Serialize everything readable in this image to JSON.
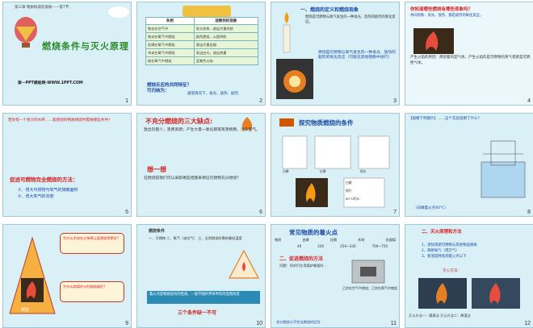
{
  "slides": [
    {
      "number": "1",
      "top_text": "第三章 物质构成的奥秘——第7节",
      "title": "燃烧条件与灭火原理",
      "url": "第一PPT模板网-WWW.1PPT.COM"
    },
    {
      "number": "2",
      "table_headers": [
        "条例",
        "观察到的现象"
      ],
      "table_rows": [
        [
          "铁丝在空气中",
          "发光发热…放出大量的热"
        ],
        [
          "铁丝在氧气中燃烧",
          "剧烈燃烧…火星四射"
        ],
        [
          "红磷在氧气中燃烧",
          "冒出大量白烟"
        ],
        [
          "木炭在氧气中燃烧",
          "发出白光，放出热量"
        ],
        [
          "硫在氧气中燃烧",
          "蓝紫色火焰"
        ]
      ],
      "question": "燃烧反应的共同特征？\n可归纳为：",
      "answer": "通常情况下，发光、放热、剧烈"
    },
    {
      "number": "3",
      "title": "一、燃烧的定义和燃烧现象",
      "text": "燃烧是可燃物与氧气发生的一种发光、放热的剧烈的氧化反应。",
      "text2": "燃烧是可燃物与氧气发生的一种发光、放热的剧烈的氧化反应（可能在其他物质中进行）"
    },
    {
      "number": "4",
      "title": "你知道哪些燃烧有哪些现象吗？",
      "text": "共同现象：发光、放热、都是剧烈的氧化反应。",
      "bottom": "产生火焰的原因：燃烧着的是气体。产生火焰的是可燃物的蒸气或者是可燃性气体。"
    },
    {
      "number": "5",
      "text": "若你有一个很大的水杯……能燃烧的物质燃烧时需要哪些条件？",
      "head": "促进可燃物完全燃烧的方法：",
      "items": [
        "①、增大可燃物与氧气的接触面积",
        "②、增大氧气的浓度"
      ]
    },
    {
      "number": "6",
      "title": "不充分燃烧的三大缺点:",
      "text": "放出热量少，浪费资源；产生大量一氧化碳等有害物质，污染空气。",
      "think": "想一想",
      "text2": "在燃烧前我们可以采取哪些措施来保证可燃物充分燃烧？"
    },
    {
      "number": "7",
      "title": "探究物质燃烧的条件",
      "labels": [
        "白磷",
        "红磷",
        "热水",
        "白磷",
        "铜片",
        "80°C的水"
      ]
    },
    {
      "number": "8",
      "text": "【观察下列图片】……这个实验说明了什么？",
      "foot": "（白磷着火点40°C）"
    },
    {
      "number": "9",
      "box1": "为什么木块在火柴棒上面燃烧得更好？",
      "box2": "为什么扇煤炉火时越扇越旺？",
      "box3": "燃烧"
    },
    {
      "number": "10",
      "title": "燃烧条件",
      "text": "一、可燃物 二、氧气（或空气） 三、达到燃烧所需的最低温度",
      "bar": "着火点是物质固有的性质，一般不随外界条件的改变而改变",
      "foot": "三个条件缺一不可"
    },
    {
      "number": "11",
      "title": "常见物质的着火点",
      "headers": [
        "物质",
        "白磷",
        "红磷",
        "木材",
        "无烟煤"
      ],
      "values": [
        "40",
        "240",
        "250~330",
        "700~750"
      ],
      "section": "二、促进燃烧的方法",
      "text": "问题：同学们在用煤炉做饭时…",
      "right": "乙烷在空气中燃烧；乙烷在氧气中燃烧",
      "foot": "充分燃烧与不完全燃烧的区别"
    },
    {
      "number": "12",
      "title": "二、灭火原理和方法",
      "items": [
        "1、清除或使可燃物与其他物品隔离",
        "2、隔绝氧气（或空气）",
        "3、使温度降低到着火点以下"
      ],
      "method": "灭火方法：",
      "bottom": "灭火方法一：隔离法 灭火方法二：降温法"
    }
  ]
}
